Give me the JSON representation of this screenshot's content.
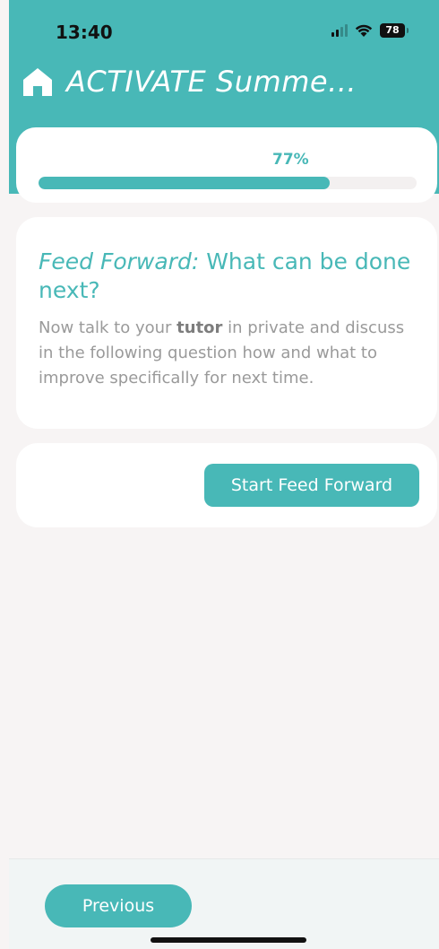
{
  "status": {
    "time": "13:40",
    "battery": "78"
  },
  "header": {
    "title": "ACTIVATE Summe...",
    "icon": "home-icon"
  },
  "progress": {
    "label": "77%",
    "value": 0.77
  },
  "feed_card": {
    "heading_italic": "Feed Forward:",
    "heading_rest": " What can be done next?",
    "desc_before": "Now talk to your ",
    "desc_bold": "tutor",
    "desc_after": " in private and discuss in the following question how and what to improve specifically for next time."
  },
  "actions": {
    "start_label": "Start Feed Forward"
  },
  "footer": {
    "previous_label": "Previous"
  },
  "colors": {
    "accent": "#48b8b7",
    "background": "#f7f4f4",
    "text_muted": "#9a9a9a"
  }
}
